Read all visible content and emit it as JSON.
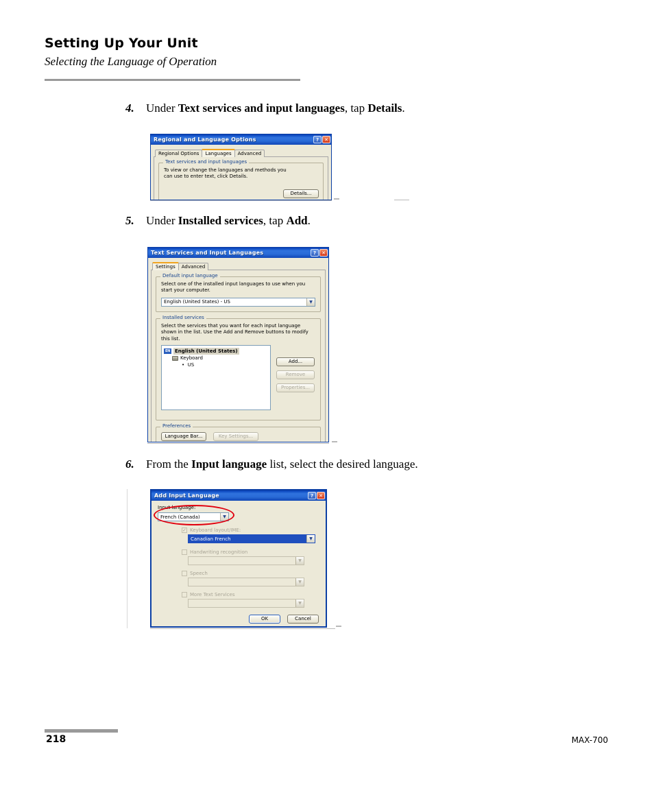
{
  "header": {
    "chapter_title": "Setting Up Your Unit",
    "section_title": "Selecting the Language of Operation"
  },
  "steps": [
    {
      "number": "4.",
      "parts": [
        {
          "text": "Under ",
          "bold": false
        },
        {
          "text": "Text services and input languages",
          "bold": true
        },
        {
          "text": ", tap ",
          "bold": false
        },
        {
          "text": "Details",
          "bold": true
        },
        {
          "text": ".",
          "bold": false
        }
      ],
      "plain": "4. Under Text services and input languages, tap Details."
    },
    {
      "number": "5.",
      "parts": [
        {
          "text": "Under ",
          "bold": false
        },
        {
          "text": "Installed services",
          "bold": true
        },
        {
          "text": ", tap ",
          "bold": false
        },
        {
          "text": "Add",
          "bold": true
        },
        {
          "text": ".",
          "bold": false
        }
      ],
      "plain": "5. Under Installed services, tap Add."
    },
    {
      "number": "6.",
      "parts": [
        {
          "text": "From the ",
          "bold": false
        },
        {
          "text": "Input language",
          "bold": true
        },
        {
          "text": " list, select the desired language.",
          "bold": false
        }
      ],
      "plain": "6. From the Input language list, select the desired language."
    }
  ],
  "dialog1": {
    "title": "Regional and Language Options",
    "help_button": "?",
    "close_button": "✕",
    "tabs": [
      {
        "label": "Regional Options",
        "active": false
      },
      {
        "label": "Languages",
        "active": true
      },
      {
        "label": "Advanced",
        "active": false
      }
    ],
    "group_title": "Text services and input languages",
    "group_text": "To view or change the languages and methods you can use to enter text, click Details.",
    "details_button": "Details..."
  },
  "dialog2": {
    "title": "Text Services and Input Languages",
    "help_button": "?",
    "close_button": "✕",
    "tabs": [
      {
        "label": "Settings",
        "active": true
      },
      {
        "label": "Advanced",
        "active": false
      }
    ],
    "default_input_language": {
      "group_title": "Default input language",
      "description": "Select one of the installed input languages to use when you start your computer.",
      "selected": "English (United States) - US"
    },
    "installed_services": {
      "group_title": "Installed services",
      "description": "Select the services that you want for each input language shown in the list. Use the Add and Remove buttons to modify this list.",
      "tree": {
        "lang_badge": "EN",
        "lang_label": "English (United States)",
        "keyboard_label": "Keyboard",
        "layout_label": "US"
      },
      "buttons": {
        "add": "Add...",
        "remove": "Remove",
        "properties": "Properties..."
      }
    },
    "preferences": {
      "group_title": "Preferences",
      "language_bar": "Language Bar...",
      "key_settings": "Key Settings..."
    }
  },
  "dialog3": {
    "title": "Add Input Language",
    "help_button": "?",
    "close_button": "✕",
    "input_language_label": "Input language:",
    "input_language_value": "French (Canada)",
    "keyboard_layout_label": "Keyboard layout/IME:",
    "keyboard_layout_value": "Canadian French",
    "handwriting_label": "Handwriting recognition",
    "handwriting_value": "",
    "speech_label": "Speech",
    "speech_value": "",
    "more_text_services_label": "More Text Services",
    "more_text_services_value": "",
    "ok_button": "OK",
    "cancel_button": "Cancel"
  },
  "footer": {
    "page_number": "218",
    "model": "MAX-700"
  },
  "colors": {
    "rule_gray": "#9a9a9a",
    "annotation_red": "#e1000f",
    "titlebar_blue": "#2f72dd",
    "dialog_face": "#ece9d8",
    "group_label_blue": "#14418c",
    "tab_accent_orange": "#f0a420"
  }
}
